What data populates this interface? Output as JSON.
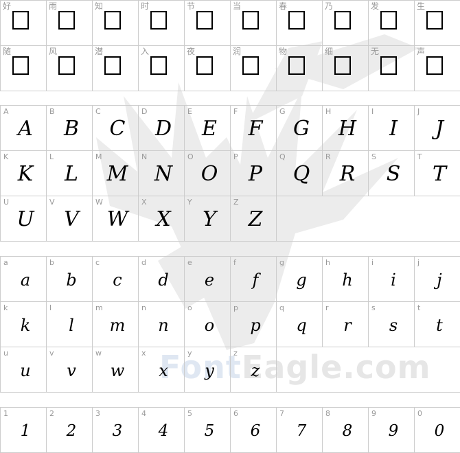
{
  "watermark": {
    "part1": "Font",
    "part2": "Eagle",
    "part3": ".com",
    "logo_icon": "eagle-icon"
  },
  "sections": {
    "cjk": [
      "好",
      "雨",
      "知",
      "时",
      "节",
      "当",
      "春",
      "乃",
      "发",
      "生",
      "随",
      "风",
      "潜",
      "入",
      "夜",
      "润",
      "物",
      "细",
      "无",
      "声"
    ],
    "upper": [
      "A",
      "B",
      "C",
      "D",
      "E",
      "F",
      "G",
      "H",
      "I",
      "J",
      "K",
      "L",
      "M",
      "N",
      "O",
      "P",
      "Q",
      "R",
      "S",
      "T",
      "U",
      "V",
      "W",
      "X",
      "Y",
      "Z"
    ],
    "lower": [
      "a",
      "b",
      "c",
      "d",
      "e",
      "f",
      "g",
      "h",
      "i",
      "j",
      "k",
      "l",
      "m",
      "n",
      "o",
      "p",
      "q",
      "r",
      "s",
      "t",
      "u",
      "v",
      "w",
      "x",
      "y",
      "z"
    ],
    "digits": [
      "1",
      "2",
      "3",
      "4",
      "5",
      "6",
      "7",
      "8",
      "9",
      "0"
    ]
  },
  "colors": {
    "grid_line": "#cccccc",
    "label": "#999999",
    "watermark": "#e6e6e6"
  }
}
